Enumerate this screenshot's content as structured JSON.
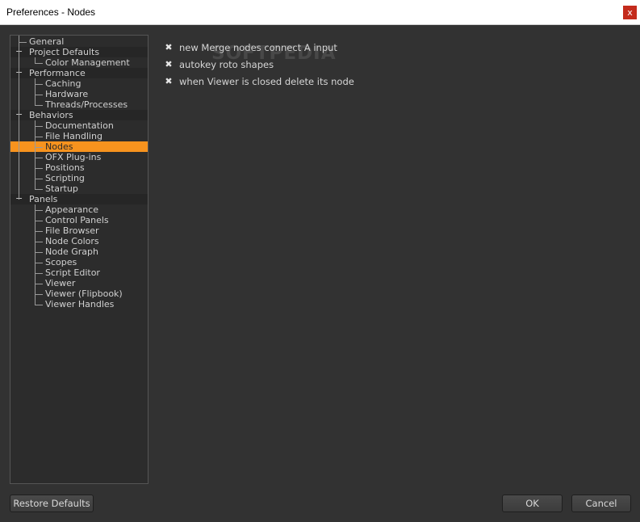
{
  "window": {
    "title": "Preferences - Nodes",
    "close_glyph": "x"
  },
  "tree": {
    "items": [
      {
        "label": "General",
        "type": "top"
      },
      {
        "label": "Project Defaults",
        "type": "section",
        "expander": "−"
      },
      {
        "label": "Color Management",
        "type": "child"
      },
      {
        "label": "Performance",
        "type": "section",
        "expander": "−"
      },
      {
        "label": "Caching",
        "type": "child"
      },
      {
        "label": "Hardware",
        "type": "child"
      },
      {
        "label": "Threads/Processes",
        "type": "child"
      },
      {
        "label": "Behaviors",
        "type": "section",
        "expander": "−"
      },
      {
        "label": "Documentation",
        "type": "child"
      },
      {
        "label": "File Handling",
        "type": "child"
      },
      {
        "label": "Nodes",
        "type": "child",
        "selected": true
      },
      {
        "label": "OFX Plug-ins",
        "type": "child"
      },
      {
        "label": "Positions",
        "type": "child"
      },
      {
        "label": "Scripting",
        "type": "child"
      },
      {
        "label": "Startup",
        "type": "child"
      },
      {
        "label": "Panels",
        "type": "section",
        "expander": "−"
      },
      {
        "label": "Appearance",
        "type": "child"
      },
      {
        "label": "Control Panels",
        "type": "child"
      },
      {
        "label": "File Browser",
        "type": "child"
      },
      {
        "label": "Node Colors",
        "type": "child"
      },
      {
        "label": "Node Graph",
        "type": "child"
      },
      {
        "label": "Scopes",
        "type": "child"
      },
      {
        "label": "Script Editor",
        "type": "child"
      },
      {
        "label": "Viewer",
        "type": "child"
      },
      {
        "label": "Viewer (Flipbook)",
        "type": "child"
      },
      {
        "label": "Viewer Handles",
        "type": "child"
      }
    ]
  },
  "options": [
    {
      "label": "new Merge nodes connect A input",
      "checked": true,
      "mark": "✖"
    },
    {
      "label": "autokey roto shapes",
      "checked": true,
      "mark": "✖"
    },
    {
      "label": "when Viewer is closed delete its node",
      "checked": true,
      "mark": "✖"
    }
  ],
  "watermark": {
    "text": "SOFTPEDIA"
  },
  "buttons": {
    "restore": "Restore Defaults",
    "ok": "OK",
    "cancel": "Cancel"
  },
  "colors": {
    "selection": "#f7931e",
    "background": "#323232",
    "close": "#c42b1c"
  }
}
